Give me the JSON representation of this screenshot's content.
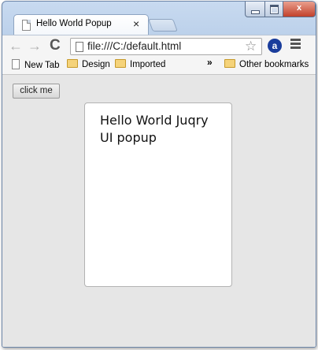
{
  "tab": {
    "title": "Hello World Popup",
    "close_glyph": "×"
  },
  "window_controls": {
    "close_glyph": "x"
  },
  "toolbar": {
    "back_glyph": "←",
    "forward_glyph": "→",
    "reload_glyph": "C",
    "url": "file:///C:/default.html",
    "star_glyph": "☆",
    "extension_glyph": "a"
  },
  "bookmarks": {
    "items": [
      {
        "label": "New Tab",
        "icon": "page-icon"
      },
      {
        "label": "Design",
        "icon": "folder-icon"
      },
      {
        "label": "Imported",
        "icon": "folder-icon"
      }
    ],
    "overflow_glyph": "»",
    "other": {
      "label": "Other bookmarks",
      "icon": "folder-icon"
    }
  },
  "page": {
    "button_label": "click me",
    "popup_text": "Hello World Juqry UI popup"
  },
  "colors": {
    "frame": "#b7cde8",
    "content_bg": "#e6e6e6",
    "close_button": "#c2412b",
    "popup_bg": "#ffffff"
  }
}
